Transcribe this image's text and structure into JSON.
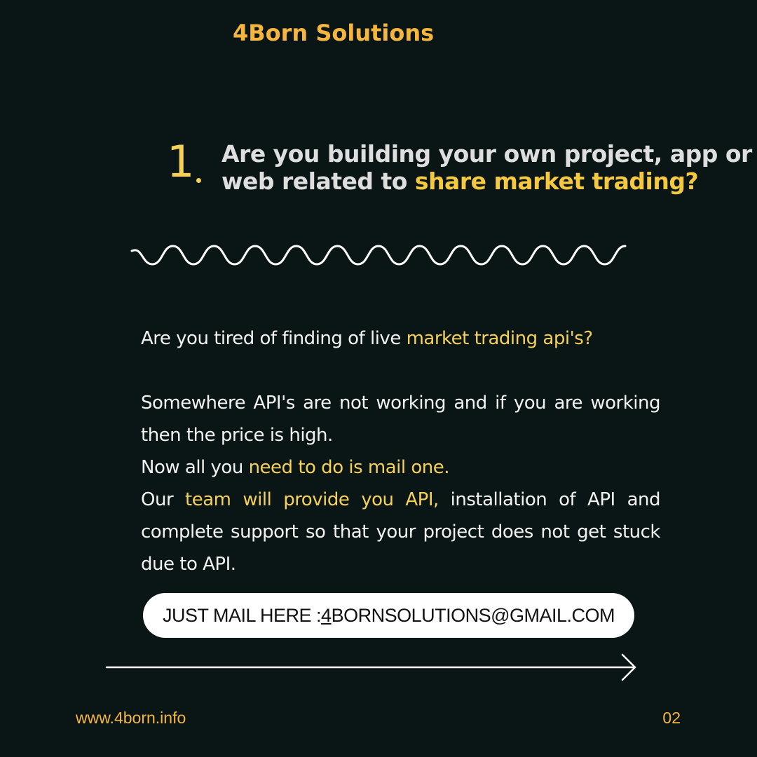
{
  "brand": "4Born Solutions",
  "question": {
    "number": "1",
    "line_plain": "Are you building your own project, app or web related to ",
    "line_highlight": "share market trading?"
  },
  "body": {
    "p1_plain": "Are you tired of finding of live ",
    "p1_highlight": "market trading api's?",
    "p2": "Somewhere API's are not working and if you are working then the price is high.",
    "p3_plain": "Now all you ",
    "p3_highlight": "need to do is mail one.",
    "p4_plain1": "Our ",
    "p4_highlight": "team will provide you API,",
    "p4_plain2": " installation of API and complete support so that your project does not get stuck due to API."
  },
  "mail": {
    "prefix": "JUST MAIL HERE : ",
    "email_first": "4",
    "email_rest": "BORNSOLUTIONS@GMAIL.COM"
  },
  "footer": {
    "url": "www.4born.info",
    "page": "02"
  },
  "colors": {
    "background": "#0a1615",
    "brand": "#f6b63d",
    "highlight": "#f5d15a",
    "text": "#f2f2f2"
  }
}
